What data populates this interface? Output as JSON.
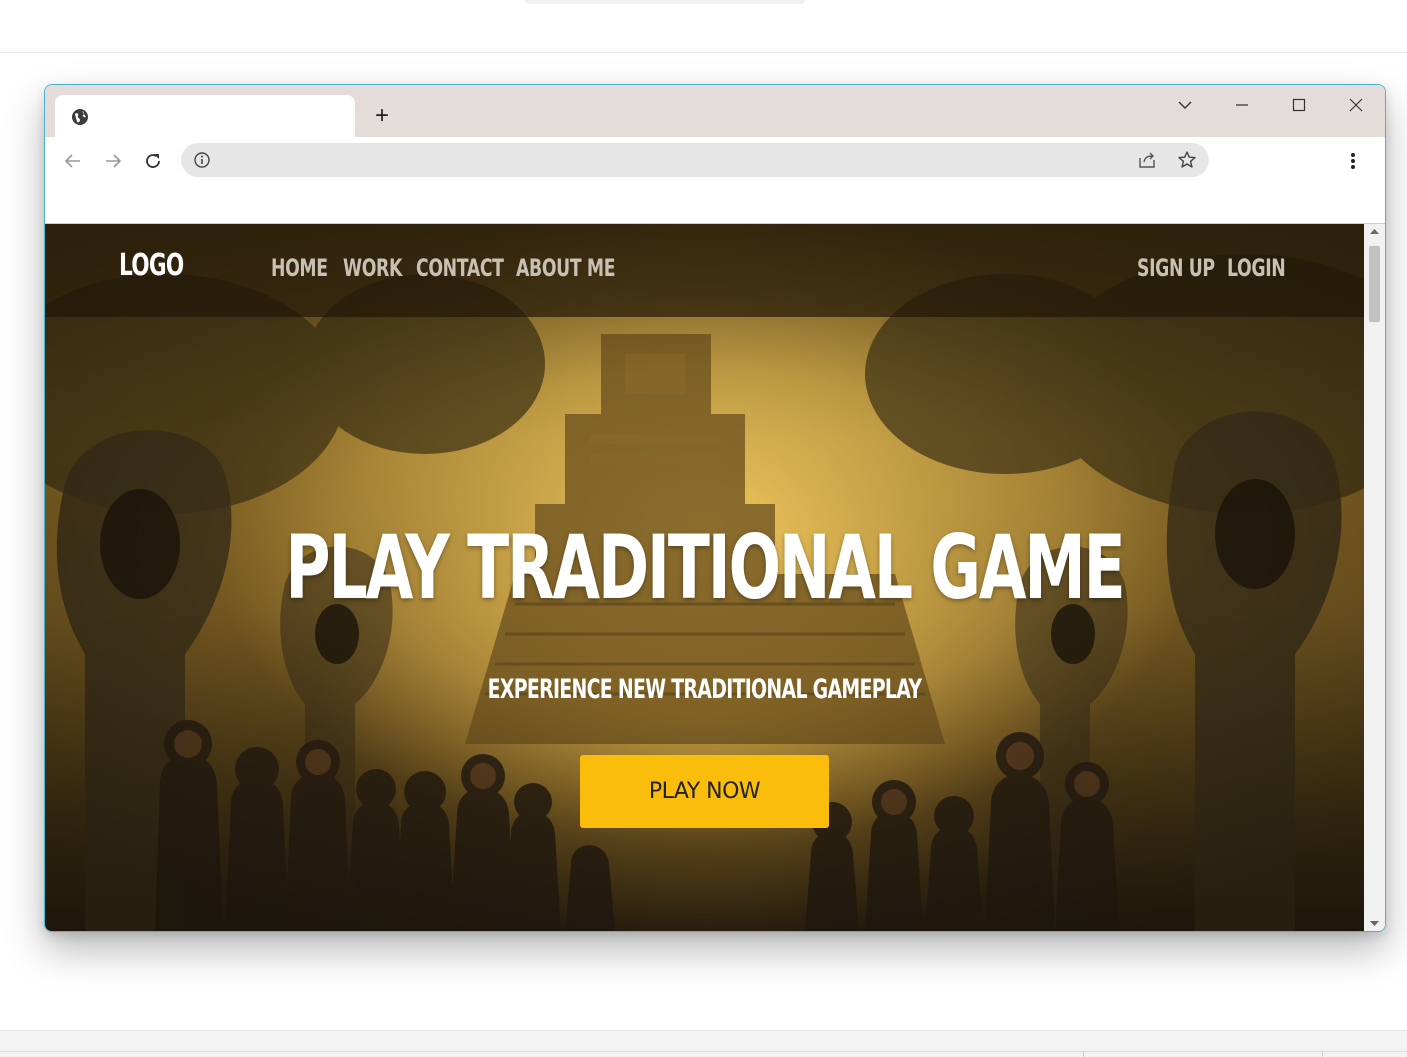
{
  "browser": {
    "tab_title": "",
    "new_tab_label": "+",
    "address": "",
    "colors": {
      "tabstrip": "#e4dcd8",
      "window_border": "#4cb3cf",
      "omnibox": "#e6e6e6"
    }
  },
  "site": {
    "logo": "LOGO",
    "nav_left": [
      "HOME",
      "WORK",
      "CONTACT",
      "ABOUT ME"
    ],
    "nav_right": [
      "SIGN UP",
      "LOGIN"
    ],
    "hero_title": "PLAY TRADITIONAL GAME",
    "hero_subtitle": "EXPERIENCE NEW TRADITIONAL GAMEPLAY",
    "cta_label": "PLAY NOW",
    "colors": {
      "cta": "#fbbd0b",
      "nav_text": "#c7c1b3",
      "hero_text": "#ffffff"
    }
  }
}
